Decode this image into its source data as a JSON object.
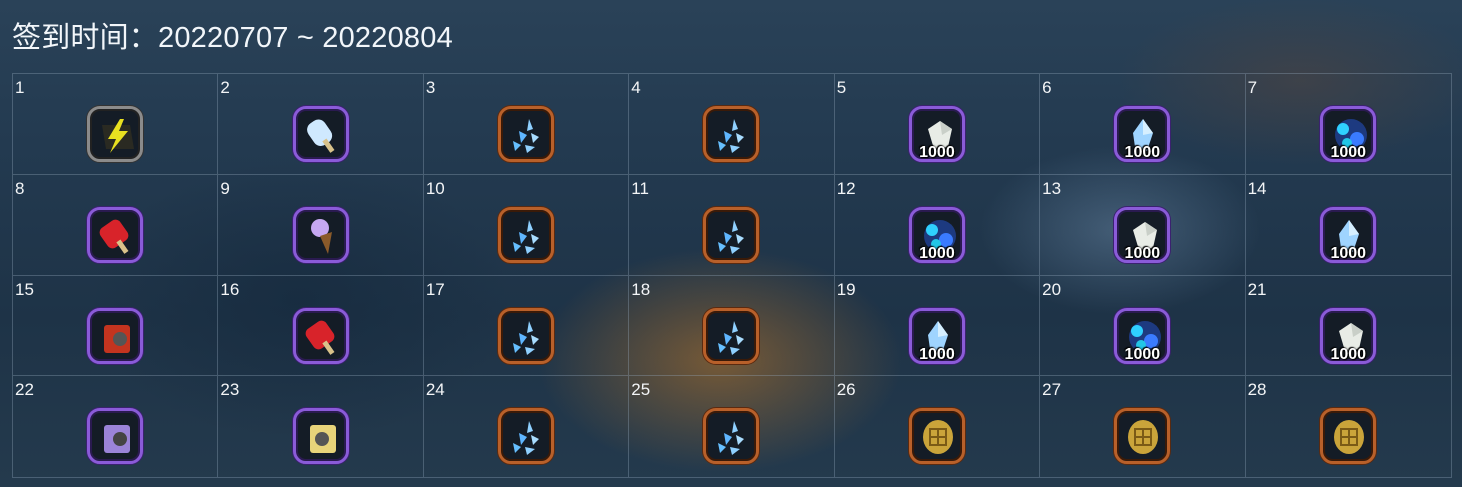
{
  "title": "签到时间：20220707 ~ 20220804",
  "days": [
    {
      "day": "1",
      "icon": "lightning-icon",
      "qty": ""
    },
    {
      "day": "2",
      "icon": "popsicle-icon",
      "qty": ""
    },
    {
      "day": "3",
      "icon": "crystal-shards-icon",
      "qty": ""
    },
    {
      "day": "4",
      "icon": "crystal-shards-icon",
      "qty": ""
    },
    {
      "day": "5",
      "icon": "white-crystal-icon",
      "qty": "1000"
    },
    {
      "day": "6",
      "icon": "blue-crystal-icon",
      "qty": "1000"
    },
    {
      "day": "7",
      "icon": "blue-ore-icon",
      "qty": "1000"
    },
    {
      "day": "8",
      "icon": "watermelon-popsicle-icon",
      "qty": ""
    },
    {
      "day": "9",
      "icon": "ice-cream-cone-icon",
      "qty": ""
    },
    {
      "day": "10",
      "icon": "crystal-shards-icon",
      "qty": ""
    },
    {
      "day": "11",
      "icon": "crystal-shards-icon",
      "qty": ""
    },
    {
      "day": "12",
      "icon": "blue-ore-icon",
      "qty": "1000"
    },
    {
      "day": "13",
      "icon": "white-crystal-icon",
      "qty": "1000"
    },
    {
      "day": "14",
      "icon": "blue-crystal-icon",
      "qty": "1000"
    },
    {
      "day": "15",
      "icon": "red-bag-icon",
      "qty": ""
    },
    {
      "day": "16",
      "icon": "watermelon-popsicle-icon",
      "qty": ""
    },
    {
      "day": "17",
      "icon": "crystal-shards-icon",
      "qty": ""
    },
    {
      "day": "18",
      "icon": "crystal-shards-icon",
      "qty": ""
    },
    {
      "day": "19",
      "icon": "blue-crystal-icon",
      "qty": "1000"
    },
    {
      "day": "20",
      "icon": "blue-ore-icon",
      "qty": "1000"
    },
    {
      "day": "21",
      "icon": "white-crystal-icon",
      "qty": "1000"
    },
    {
      "day": "22",
      "icon": "purple-bag-icon",
      "qty": ""
    },
    {
      "day": "23",
      "icon": "gold-bag-icon",
      "qty": ""
    },
    {
      "day": "24",
      "icon": "crystal-shards-icon",
      "qty": ""
    },
    {
      "day": "25",
      "icon": "crystal-shards-icon",
      "qty": ""
    },
    {
      "day": "26",
      "icon": "gold-coin-icon",
      "qty": ""
    },
    {
      "day": "27",
      "icon": "gold-coin-icon",
      "qty": ""
    },
    {
      "day": "28",
      "icon": "gold-coin-icon",
      "qty": ""
    }
  ]
}
